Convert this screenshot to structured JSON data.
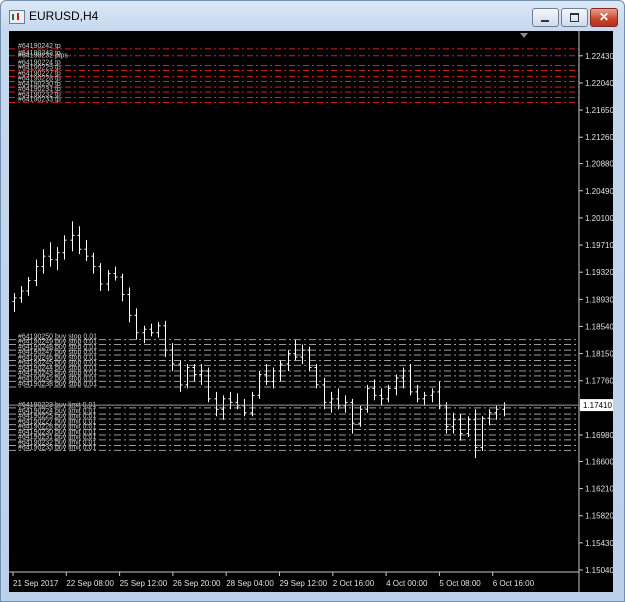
{
  "window": {
    "title": "EURUSD,H4"
  },
  "price_axis": {
    "min": 1.1504,
    "max": 1.227,
    "labels": [
      "1.22430",
      "1.22040",
      "1.21650",
      "1.21260",
      "1.20880",
      "1.20490",
      "1.20100",
      "1.19710",
      "1.19320",
      "1.18930",
      "1.18540",
      "1.18150",
      "1.17760",
      "1.17370",
      "1.16980",
      "1.16600",
      "1.16210",
      "1.15820",
      "1.15430",
      "1.15040"
    ],
    "current_price": "1.17410"
  },
  "time_axis": {
    "labels": [
      "21 Sep 2017",
      "22 Sep 08:00",
      "25 Sep 12:00",
      "26 Sep 20:00",
      "28 Sep 04:00",
      "29 Sep 12:00",
      "2 Oct 16:00",
      "4 Oct 00:00",
      "5 Oct 08:00",
      "6 Oct 16:00"
    ]
  },
  "tp_levels": {
    "color": "#d81e1e",
    "labels": [
      "#64190242 tp",
      "#64190242 tp",
      "#64190224 tp",
      "#64190225 tp",
      "#64190227 tp",
      "#64190228 tp",
      "#64190230 tp",
      "#64190231 tp",
      "#64190232 tp",
      "#64190233 tp"
    ],
    "prices": [
      1.2253,
      1.2243,
      1.2229,
      1.2222,
      1.2213,
      1.2206,
      1.2198,
      1.2191,
      1.2183,
      1.2176
    ],
    "extra_label": "#64190232 pips"
  },
  "buy_stop_orders": {
    "color": "#9a9a9a",
    "labels": [
      "#64190250 buy stop 0.01",
      "#64190249 buy stop 0.01",
      "#64190248 buy stop 0.01",
      "#64190247 buy stop 0.01",
      "#64190246 buy stop 0.01",
      "#64190245 buy stop 0.01",
      "#64190244 buy stop 0.01",
      "#64190243 buy stop 0.01",
      "#64190242 buy stop 0.01",
      "#64190238 buy stop 0.01"
    ],
    "prices": [
      1.1835,
      1.1828,
      1.182,
      1.1813,
      1.1805,
      1.1798,
      1.179,
      1.1783,
      1.1775,
      1.1767
    ]
  },
  "buy_limit_orders": {
    "color": "#9a9a9a",
    "labels": [
      "#64190223 buy limit 0.01",
      "#64190224 buy limit 0.01",
      "#64190225 buy limit 0.01",
      "#64190227 buy limit 0.01",
      "#64190228 buy limit 0.01",
      "#64190230 buy limit 0.01",
      "#64190231 buy limit 0.01",
      "#64190232 buy limit 0.01",
      "#64190233 buy limit 0.01"
    ],
    "prices": [
      1.1737,
      1.1728,
      1.1721,
      1.1713,
      1.1706,
      1.1698,
      1.1691,
      1.1683,
      1.1676
    ]
  },
  "chart_data": {
    "type": "ohlc",
    "symbol": "EURUSD",
    "timeframe": "H4",
    "ylim": [
      1.1504,
      1.227
    ],
    "bars": [
      [
        1.189,
        1.1902,
        1.1875,
        1.1895
      ],
      [
        1.1895,
        1.1912,
        1.1888,
        1.1905
      ],
      [
        1.1905,
        1.1925,
        1.1898,
        1.192
      ],
      [
        1.192,
        1.195,
        1.1912,
        1.194
      ],
      [
        1.194,
        1.1965,
        1.193,
        1.1955
      ],
      [
        1.1955,
        1.1975,
        1.194,
        1.195
      ],
      [
        1.195,
        1.1968,
        1.1935,
        1.196
      ],
      [
        1.196,
        1.1985,
        1.195,
        1.1978
      ],
      [
        1.1978,
        1.2005,
        1.1962,
        1.1985
      ],
      [
        1.1985,
        1.1998,
        1.1958,
        1.1965
      ],
      [
        1.1965,
        1.1978,
        1.1948,
        1.1955
      ],
      [
        1.1955,
        1.196,
        1.193,
        1.194
      ],
      [
        1.194,
        1.1945,
        1.1905,
        1.1915
      ],
      [
        1.1915,
        1.1935,
        1.1905,
        1.193
      ],
      [
        1.193,
        1.194,
        1.192,
        1.1925
      ],
      [
        1.1925,
        1.193,
        1.189,
        1.19
      ],
      [
        1.19,
        1.191,
        1.186,
        1.187
      ],
      [
        1.187,
        1.188,
        1.1835,
        1.1845
      ],
      [
        1.1845,
        1.1855,
        1.183,
        1.185
      ],
      [
        1.185,
        1.1858,
        1.184,
        1.1845
      ],
      [
        1.1845,
        1.186,
        1.1838,
        1.1855
      ],
      [
        1.1855,
        1.1862,
        1.181,
        1.182
      ],
      [
        1.182,
        1.183,
        1.179,
        1.18
      ],
      [
        1.18,
        1.1805,
        1.176,
        1.177
      ],
      [
        1.177,
        1.18,
        1.1765,
        1.1795
      ],
      [
        1.1795,
        1.18,
        1.1775,
        1.1785
      ],
      [
        1.1785,
        1.18,
        1.177,
        1.179
      ],
      [
        1.179,
        1.1795,
        1.1745,
        1.175
      ],
      [
        1.175,
        1.176,
        1.1725,
        1.1735
      ],
      [
        1.1735,
        1.1755,
        1.172,
        1.175
      ],
      [
        1.175,
        1.176,
        1.1735,
        1.1745
      ],
      [
        1.1745,
        1.1758,
        1.1735,
        1.174
      ],
      [
        1.174,
        1.175,
        1.1725,
        1.173
      ],
      [
        1.173,
        1.176,
        1.1725,
        1.1755
      ],
      [
        1.1755,
        1.179,
        1.175,
        1.1785
      ],
      [
        1.1785,
        1.18,
        1.177,
        1.1775
      ],
      [
        1.1775,
        1.1795,
        1.1765,
        1.179
      ],
      [
        1.179,
        1.1805,
        1.1775,
        1.18
      ],
      [
        1.18,
        1.182,
        1.179,
        1.1815
      ],
      [
        1.1815,
        1.1835,
        1.1805,
        1.181
      ],
      [
        1.181,
        1.1828,
        1.18,
        1.182
      ],
      [
        1.182,
        1.1825,
        1.179,
        1.1795
      ],
      [
        1.1795,
        1.18,
        1.1765,
        1.177
      ],
      [
        1.177,
        1.178,
        1.1735,
        1.1745
      ],
      [
        1.1745,
        1.176,
        1.173,
        1.175
      ],
      [
        1.175,
        1.1765,
        1.1735,
        1.174
      ],
      [
        1.174,
        1.1755,
        1.173,
        1.1745
      ],
      [
        1.1745,
        1.175,
        1.17,
        1.1715
      ],
      [
        1.1715,
        1.174,
        1.171,
        1.1735
      ],
      [
        1.1735,
        1.177,
        1.173,
        1.1765
      ],
      [
        1.1765,
        1.1778,
        1.1748,
        1.1755
      ],
      [
        1.1755,
        1.1765,
        1.174,
        1.175
      ],
      [
        1.175,
        1.177,
        1.1745,
        1.1765
      ],
      [
        1.1765,
        1.1785,
        1.1755,
        1.178
      ],
      [
        1.178,
        1.1795,
        1.1765,
        1.179
      ],
      [
        1.179,
        1.18,
        1.1755,
        1.176
      ],
      [
        1.176,
        1.177,
        1.1745,
        1.175
      ],
      [
        1.175,
        1.176,
        1.174,
        1.1755
      ],
      [
        1.1755,
        1.1765,
        1.1745,
        1.176
      ],
      [
        1.176,
        1.1775,
        1.1735,
        1.174
      ],
      [
        1.174,
        1.1745,
        1.17,
        1.171
      ],
      [
        1.171,
        1.173,
        1.17,
        1.172
      ],
      [
        1.172,
        1.1728,
        1.169,
        1.17
      ],
      [
        1.17,
        1.1725,
        1.1695,
        1.172
      ],
      [
        1.172,
        1.1735,
        1.1665,
        1.168
      ],
      [
        1.168,
        1.1725,
        1.1675,
        1.1722
      ],
      [
        1.1722,
        1.1735,
        1.1712,
        1.173
      ],
      [
        1.173,
        1.174,
        1.172,
        1.1735
      ],
      [
        1.1735,
        1.1745,
        1.1725,
        1.1741
      ]
    ]
  }
}
